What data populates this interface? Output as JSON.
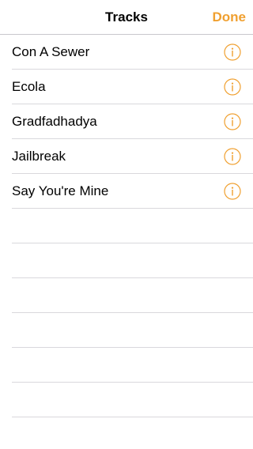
{
  "navbar": {
    "title": "Tracks",
    "done_label": "Done"
  },
  "tracks": [
    {
      "label": "Con A Sewer",
      "icon": "info-icon"
    },
    {
      "label": "Ecola",
      "icon": "info-icon"
    },
    {
      "label": "Gradfadhadya",
      "icon": "info-icon"
    },
    {
      "label": "Jailbreak",
      "icon": "info-icon"
    },
    {
      "label": "Say You're Mine",
      "icon": "info-icon"
    }
  ],
  "colors": {
    "accent": "#f0a030",
    "separator": "#d9d8dc",
    "text": "#000000",
    "background": "#ffffff"
  }
}
